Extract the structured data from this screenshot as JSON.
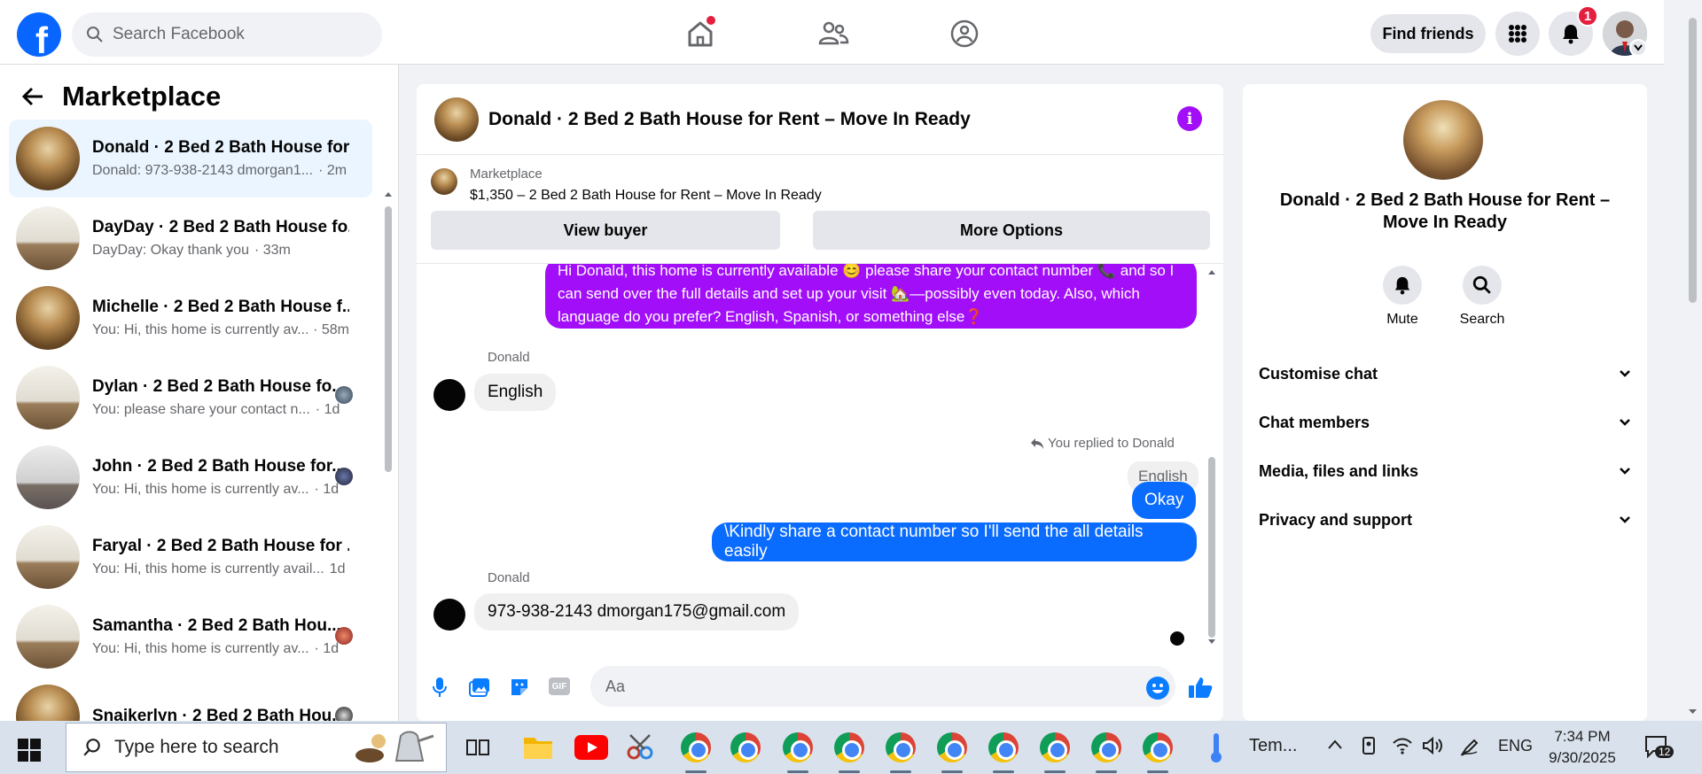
{
  "topbar": {
    "search_placeholder": "Search Facebook",
    "find_friends": "Find friends",
    "notification_count": "1"
  },
  "sidebar": {
    "title": "Marketplace",
    "conversations": [
      {
        "name": "Donald · 2 Bed 2 Bath House for...",
        "snippet": "Donald: 973-938-2143 dmorgan1...",
        "time": "· 2m"
      },
      {
        "name": "DayDay · 2 Bed 2 Bath House fo...",
        "snippet": "DayDay: Okay thank you",
        "time": "· 33m"
      },
      {
        "name": "Michelle · 2 Bed 2 Bath House f...",
        "snippet": "You: Hi, this home is currently av...",
        "time": "· 58m"
      },
      {
        "name": "Dylan · 2 Bed 2 Bath House fo...",
        "snippet": "You: please share your contact n...",
        "time": "· 1d"
      },
      {
        "name": "John · 2 Bed 2 Bath House for...",
        "snippet": "You: Hi, this home is currently av...",
        "time": "· 1d"
      },
      {
        "name": "Faryal · 2 Bed 2 Bath House for ...",
        "snippet": "You: Hi, this home is currently avail...",
        "time": "1d"
      },
      {
        "name": "Samantha · 2 Bed 2 Bath Hou...",
        "snippet": "You: Hi, this home is currently av...",
        "time": "· 1d"
      },
      {
        "name": "Snaikerlyn · 2 Bed 2 Bath Hou...",
        "snippet": "",
        "time": ""
      }
    ]
  },
  "chat": {
    "title": "Donald · 2 Bed 2 Bath House for Rent – Move In Ready",
    "listing_source": "Marketplace",
    "listing_price": "$1,350 – 2 Bed 2 Bath House for Rent – Move In Ready",
    "view_buyer": "View buyer",
    "more_options": "More Options",
    "msg_out_1": "Hi Donald, this home is currently available 😊 please share your contact number 📞 and  so I can send over the full details and set up your visit 🏡—possibly even today. Also, which language do you prefer? English, Spanish, or something else❓",
    "sender_1": "Donald",
    "msg_in_1": "English",
    "reply_note": "You replied to Donald",
    "replied_quote": "English",
    "msg_out_2": "Okay",
    "msg_out_3": "\\Kindly share a contact number so I'll send the all details easily",
    "sender_2": "Donald",
    "msg_in_2": "973-938-2143  dmorgan175@gmail.com",
    "input_placeholder": "Aa",
    "gif_label": "GIF"
  },
  "info_panel": {
    "title": "Donald · 2 Bed 2 Bath House for Rent – Move In Ready",
    "mute": "Mute",
    "search": "Search",
    "sections": [
      "Customise chat",
      "Chat members",
      "Media, files and links",
      "Privacy and support"
    ]
  },
  "taskbar": {
    "search_placeholder": "Type here to search",
    "weather": "Tem...",
    "language": "ENG",
    "time": "7:34 PM",
    "date": "9/30/2025",
    "notifications": "12"
  },
  "colors": {
    "brand": "#0866ff",
    "outgoing_purple": "#a10ef7",
    "outgoing_blue": "#0a6cff",
    "badge_red": "#e41e3f"
  }
}
